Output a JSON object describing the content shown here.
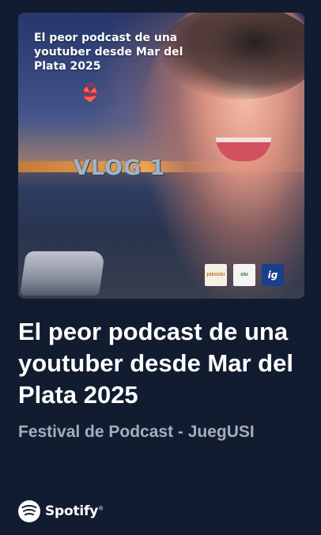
{
  "cover": {
    "title": "El peor podcast de una youtuber desde Mar del Plata 2025",
    "emoji": "👙",
    "vlog_label": "VLOG 1",
    "logos": [
      {
        "name": "juegusi-logo",
        "text": "JUEGUSI"
      },
      {
        "name": "usi-logo",
        "text": "USI"
      },
      {
        "name": "ig-logo",
        "text": "ig"
      }
    ]
  },
  "episode": {
    "title": "El peor podcast de una youtuber desde Mar del Plata 2025",
    "show": "Festival de Podcast - JuegUSI"
  },
  "brand": {
    "icon": "spotify-icon",
    "name": "Spotify",
    "trademark": "®"
  },
  "colors": {
    "background": "#121c30",
    "title": "#ffffff",
    "subtitle": "#a8acb8"
  }
}
